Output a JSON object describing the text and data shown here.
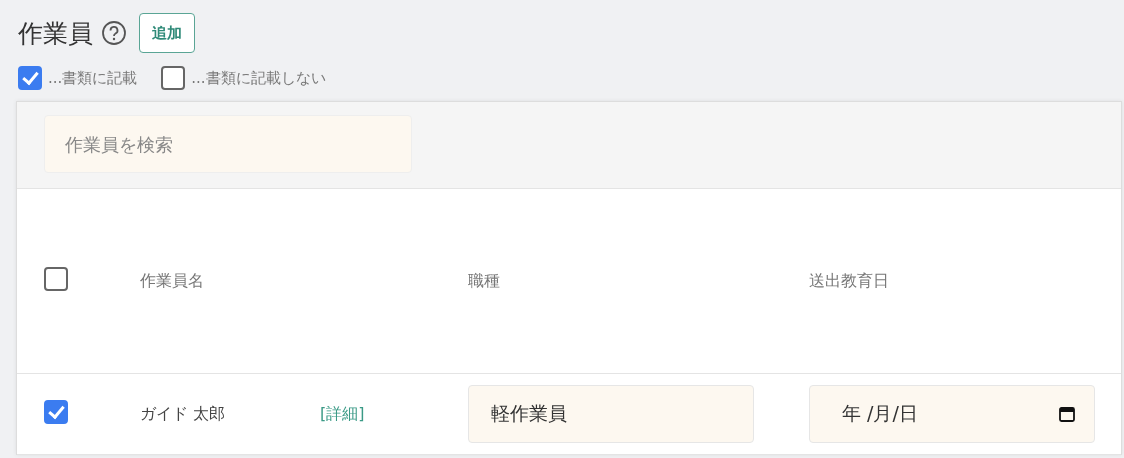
{
  "header": {
    "title": "作業員",
    "add_button": "追加"
  },
  "filters": [
    {
      "label": "...書類に記載",
      "checked": true
    },
    {
      "label": "...書類に記載しない",
      "checked": false
    }
  ],
  "search": {
    "placeholder": "作業員を検索"
  },
  "table": {
    "select_all": {
      "checked": false
    },
    "columns": [
      "作業員名",
      "職種",
      "送出教育日"
    ],
    "rows": [
      {
        "checked": true,
        "name": "ガイド 太郎",
        "detail_link": "[詳細]",
        "job": "軽作業員",
        "date": "年 /月/日"
      }
    ]
  }
}
